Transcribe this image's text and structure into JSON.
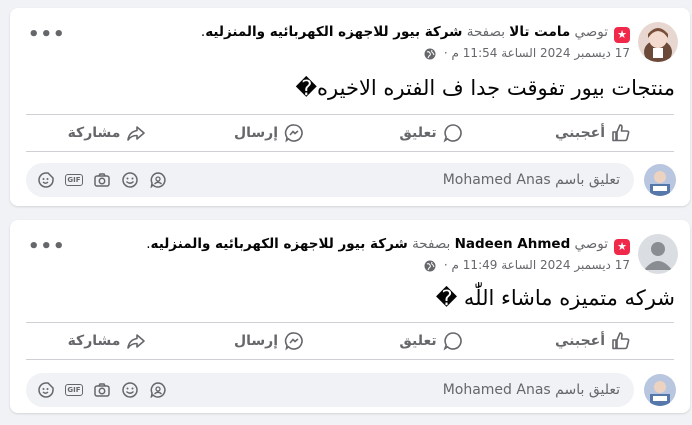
{
  "posts": [
    {
      "recommend_label": "توصي",
      "author": "مامت تالا",
      "page_prefix": "بصفحة",
      "page_name": "شركة بيور للاجهزه الكهربائيه والمنزليه",
      "page_suffix": ".",
      "timestamp": "17 ديسمبر 2024 الساعة 11:54 م ·",
      "text": "منتجات بيور تفوقت جدا ف الفتره الاخيره�",
      "like_label": "أعجبني",
      "comment_label": "تعليق",
      "send_label": "إرسال",
      "share_label": "مشاركة",
      "comment_placeholder": "تعليق باسم Mohamed Anas",
      "avatar_type": "photo"
    },
    {
      "recommend_label": "توصي",
      "author": "Nadeen Ahmed",
      "page_prefix": "بصفحة",
      "page_name": "شركة بيور للاجهزه الكهربائيه والمنزليه",
      "page_suffix": ".",
      "timestamp": "17 ديسمبر 2024 الساعة 11:49 م ·",
      "text": "شركه متميزه ماشاء اللّٰه �",
      "like_label": "أعجبني",
      "comment_label": "تعليق",
      "send_label": "إرسال",
      "share_label": "مشاركة",
      "comment_placeholder": "تعليق باسم Mohamed Anas",
      "avatar_type": "default"
    }
  ],
  "icons": {
    "recommend": "recommend-star-icon",
    "privacy": "globe-icon",
    "more": "more-options-icon",
    "like": "thumbs-up-icon",
    "comment": "comment-bubble-icon",
    "send": "messenger-send-icon",
    "share": "share-arrow-icon",
    "sticker": "sticker-icon",
    "gif": "gif-icon",
    "camera": "camera-icon",
    "emoji": "emoji-icon",
    "avatar_sticker": "avatar-sticker-icon"
  },
  "colors": {
    "background": "#f0f2f5",
    "card": "#ffffff",
    "text": "#050505",
    "muted": "#65676b",
    "recommend": "#f02849"
  }
}
